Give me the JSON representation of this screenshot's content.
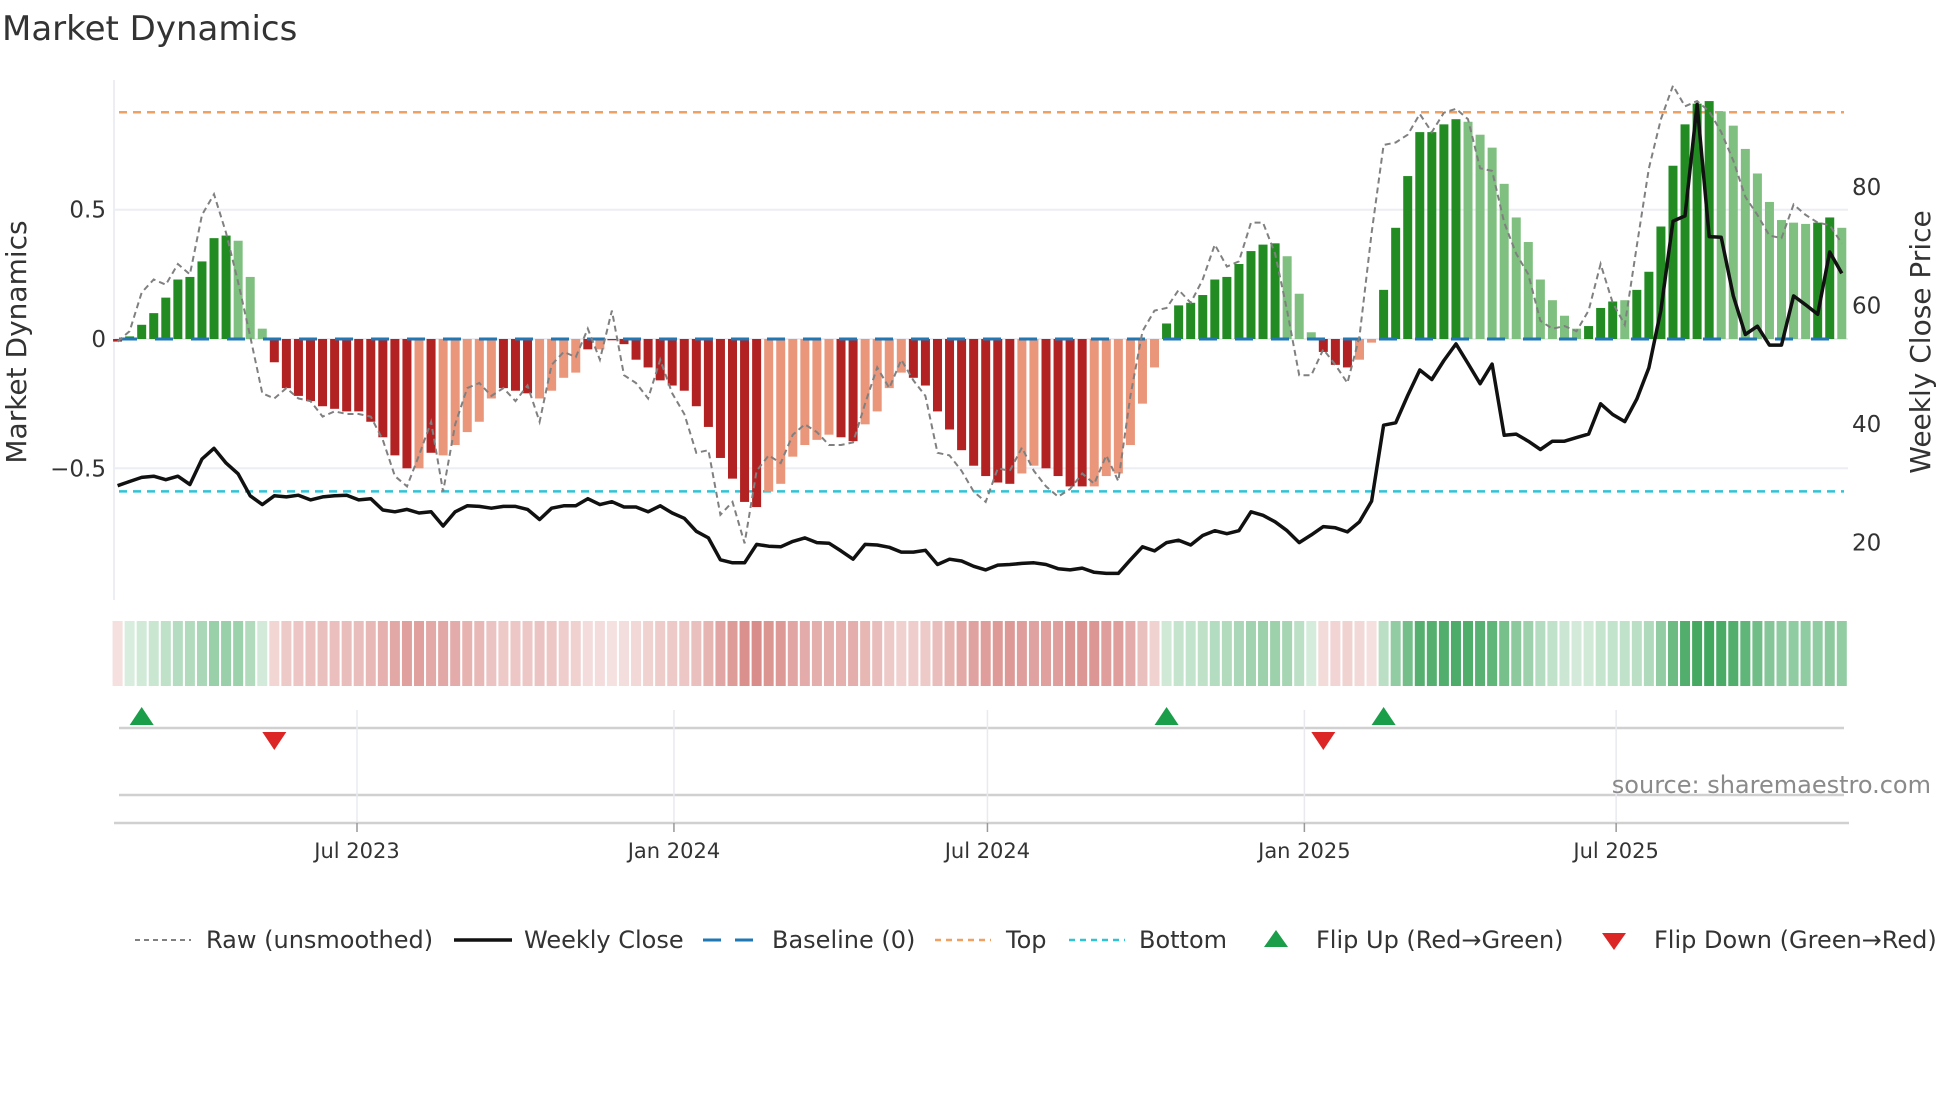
{
  "chart_data": {
    "type": "bar",
    "title": "Market Dynamics",
    "ylabel": "Market Dynamics",
    "y2label": "Weekly Close Price",
    "source": "source: sharemaestro.com",
    "start_week": "2023-02-12",
    "frequency": "weekly",
    "ylim": [
      -0.95,
      0.98
    ],
    "y2lim": [
      10,
      96
    ],
    "left_ticks": [
      {
        "v": -0.5,
        "label": "−0.5"
      },
      {
        "v": 0,
        "label": "0"
      },
      {
        "v": 0.5,
        "label": "0.5"
      }
    ],
    "right_ticks": [
      {
        "v": 20,
        "label": "20"
      },
      {
        "v": 40,
        "label": "40"
      },
      {
        "v": 60,
        "label": "60"
      },
      {
        "v": 80,
        "label": "80"
      }
    ],
    "date_ticks": [
      {
        "date": "2023-07-01",
        "label": "Jul 2023"
      },
      {
        "date": "2024-01-01",
        "label": "Jan 2024"
      },
      {
        "date": "2024-07-01",
        "label": "Jul 2024"
      },
      {
        "date": "2025-01-01",
        "label": "Jan 2025"
      },
      {
        "date": "2025-07-01",
        "label": "Jul 2025"
      }
    ],
    "top_level": 0.877,
    "bottom_level": -0.589,
    "baseline": 0,
    "colors": {
      "strong_up": "#228b22",
      "weak_up": "#7fbf7f",
      "strong_down": "#b22222",
      "weak_down": "#e9967a",
      "raw": "#808080",
      "close": "#111111",
      "baseline": "#1f77b4",
      "top": "#f0a060",
      "bottom": "#2ec4d6",
      "flip_up": "#1a9e4a",
      "flip_down": "#dc2626",
      "strip_up": "#2e9e4f",
      "strip_down": "#c85a55"
    },
    "smoothed": [
      -0.01,
      0.01,
      0.055,
      0.1,
      0.16,
      0.23,
      0.24,
      0.3,
      0.39,
      0.4,
      0.38,
      0.24,
      0.04,
      -0.09,
      -0.19,
      -0.22,
      -0.24,
      -0.26,
      -0.27,
      -0.28,
      -0.28,
      -0.32,
      -0.38,
      -0.45,
      -0.5,
      -0.5,
      -0.44,
      -0.45,
      -0.41,
      -0.36,
      -0.32,
      -0.23,
      -0.19,
      -0.2,
      -0.21,
      -0.23,
      -0.2,
      -0.15,
      -0.13,
      -0.04,
      -0.04,
      -0.005,
      -0.02,
      -0.08,
      -0.11,
      -0.16,
      -0.18,
      -0.2,
      -0.26,
      -0.34,
      -0.46,
      -0.54,
      -0.63,
      -0.65,
      -0.59,
      -0.56,
      -0.455,
      -0.41,
      -0.39,
      -0.37,
      -0.38,
      -0.395,
      -0.33,
      -0.28,
      -0.19,
      -0.13,
      -0.15,
      -0.18,
      -0.28,
      -0.35,
      -0.43,
      -0.49,
      -0.53,
      -0.555,
      -0.56,
      -0.52,
      -0.49,
      -0.5,
      -0.53,
      -0.57,
      -0.57,
      -0.57,
      -0.53,
      -0.52,
      -0.41,
      -0.25,
      -0.11,
      0.06,
      0.13,
      0.14,
      0.17,
      0.23,
      0.24,
      0.29,
      0.34,
      0.365,
      0.37,
      0.32,
      0.175,
      0.026,
      -0.05,
      -0.1,
      -0.11,
      -0.08,
      -0.014,
      0.19,
      0.43,
      0.63,
      0.8,
      0.8,
      0.83,
      0.85,
      0.84,
      0.79,
      0.74,
      0.6,
      0.47,
      0.375,
      0.23,
      0.15,
      0.09,
      0.04,
      0.05,
      0.12,
      0.145,
      0.15,
      0.19,
      0.26,
      0.435,
      0.67,
      0.83,
      0.91,
      0.92,
      0.88,
      0.825,
      0.735,
      0.64,
      0.53,
      0.46,
      0.45,
      0.445,
      0.45,
      0.47,
      0.43
    ],
    "regime": "RGGGGGGGGGLLLRRRRRRRRRRRRrRrrrrrRRRrrrrRrRRRRRRRRRRRRRrrrrrrRRrrrrRRRRRRRRRrrRRRRrrrrrrGGGGGGGGGGLLLRRRrrGGGGGGGLLLLLLLLLLGGGLGGGGGGGLLLLLLLLGGL",
    "raw": [
      -0.01,
      0.03,
      0.18,
      0.23,
      0.21,
      0.29,
      0.25,
      0.48,
      0.56,
      0.41,
      0.22,
      0.01,
      -0.21,
      -0.23,
      -0.19,
      -0.23,
      -0.24,
      -0.3,
      -0.28,
      -0.29,
      -0.29,
      -0.3,
      -0.39,
      -0.53,
      -0.57,
      -0.45,
      -0.32,
      -0.59,
      -0.33,
      -0.19,
      -0.17,
      -0.22,
      -0.19,
      -0.24,
      -0.18,
      -0.32,
      -0.1,
      -0.05,
      -0.07,
      0.04,
      -0.08,
      0.11,
      -0.14,
      -0.17,
      -0.23,
      -0.08,
      -0.21,
      -0.29,
      -0.44,
      -0.43,
      -0.68,
      -0.63,
      -0.79,
      -0.51,
      -0.45,
      -0.48,
      -0.37,
      -0.33,
      -0.36,
      -0.41,
      -0.41,
      -0.4,
      -0.25,
      -0.11,
      -0.19,
      -0.08,
      -0.16,
      -0.22,
      -0.44,
      -0.45,
      -0.51,
      -0.59,
      -0.63,
      -0.5,
      -0.51,
      -0.42,
      -0.51,
      -0.57,
      -0.61,
      -0.58,
      -0.52,
      -0.56,
      -0.45,
      -0.55,
      -0.22,
      0.03,
      0.11,
      0.12,
      0.19,
      0.14,
      0.23,
      0.365,
      0.28,
      0.3,
      0.45,
      0.45,
      0.33,
      0.11,
      -0.14,
      -0.14,
      -0.04,
      -0.1,
      -0.17,
      0.01,
      0.41,
      0.75,
      0.76,
      0.79,
      0.87,
      0.8,
      0.875,
      0.89,
      0.85,
      0.66,
      0.65,
      0.45,
      0.33,
      0.25,
      0.07,
      0.04,
      0.05,
      0.03,
      0.11,
      0.29,
      0.14,
      0.055,
      0.36,
      0.66,
      0.85,
      0.98,
      0.9,
      0.92,
      0.88,
      0.8,
      0.69,
      0.55,
      0.48,
      0.4,
      0.39,
      0.52,
      0.48,
      0.45,
      0.44,
      0.37
    ],
    "weekly_close": [
      29.6,
      30.3,
      31.0,
      31.2,
      30.6,
      31.2,
      29.8,
      34.1,
      35.9,
      33.4,
      31.6,
      27.9,
      26.4,
      27.9,
      27.7,
      28.0,
      27.2,
      27.7,
      27.9,
      28.0,
      27.2,
      27.4,
      25.5,
      25.2,
      25.6,
      25.0,
      25.2,
      22.8,
      25.2,
      26.2,
      26.1,
      25.8,
      26.1,
      26.1,
      25.6,
      23.9,
      25.8,
      26.2,
      26.2,
      27.4,
      26.4,
      26.9,
      26.0,
      26.0,
      25.2,
      26.2,
      25.0,
      24.1,
      21.9,
      20.8,
      17.1,
      16.6,
      16.6,
      19.7,
      19.4,
      19.3,
      20.2,
      20.8,
      20.0,
      19.9,
      18.6,
      17.2,
      19.7,
      19.6,
      19.2,
      18.4,
      18.4,
      18.7,
      16.3,
      17.2,
      16.9,
      16.0,
      15.4,
      16.2,
      16.3,
      16.5,
      16.6,
      16.3,
      15.6,
      15.4,
      15.7,
      15.0,
      14.8,
      14.8,
      17.1,
      19.3,
      18.6,
      20.0,
      20.4,
      19.6,
      21.2,
      22.0,
      21.5,
      22.0,
      25.2,
      24.6,
      23.5,
      22.0,
      20.0,
      21.3,
      22.7,
      22.5,
      21.8,
      23.5,
      27.0,
      39.8,
      40.2,
      44.8,
      49.1,
      47.5,
      50.7,
      53.5,
      50.2,
      46.8,
      50.1,
      38.1,
      38.3,
      37.1,
      35.7,
      37.1,
      37.1,
      37.7,
      38.3,
      43.4,
      41.6,
      40.4,
      44.2,
      49.5,
      59.2,
      74.2,
      75.1,
      93.9,
      71.6,
      71.5,
      61.6,
      55.1,
      56.5,
      53.3,
      53.3,
      61.6,
      60.1,
      58.5,
      69.0,
      65.4
    ],
    "flips": [
      {
        "week": 3,
        "type": "up"
      },
      {
        "week": 14,
        "type": "down"
      },
      {
        "week": 88,
        "type": "up"
      },
      {
        "week": 101,
        "type": "down"
      },
      {
        "week": 106,
        "type": "up"
      }
    ],
    "legend": {
      "placement": "bottom",
      "items": [
        {
          "label": "Raw (unsmoothed)",
          "style": "raw"
        },
        {
          "label": "Weekly Close",
          "style": "close"
        },
        {
          "label": "Baseline (0)",
          "style": "baseline"
        },
        {
          "label": "Top",
          "style": "top"
        },
        {
          "label": "Bottom",
          "style": "bottom"
        },
        {
          "label": "Flip Up (Red→Green)",
          "style": "flip_up"
        },
        {
          "label": "Flip Down (Green→Red)",
          "style": "flip_down"
        }
      ]
    }
  }
}
